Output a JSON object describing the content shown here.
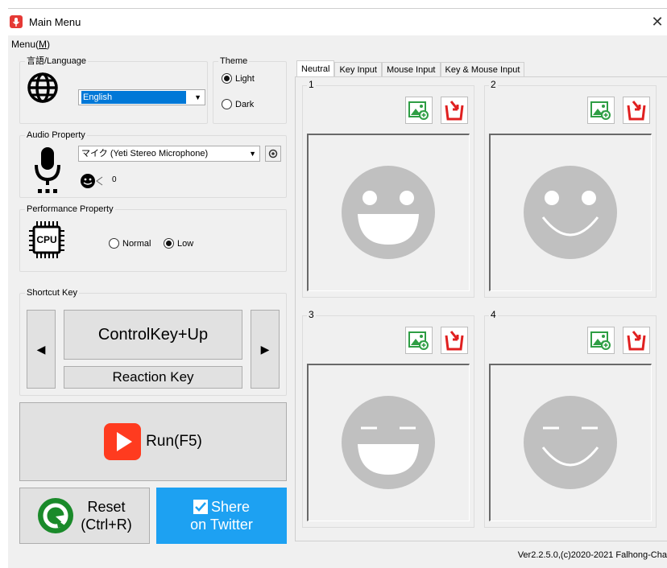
{
  "window": {
    "title": "Main Menu"
  },
  "menu": {
    "label": "Menu(",
    "accel": "M",
    "close": ")"
  },
  "language": {
    "group_label": "言語/Language",
    "selected": "English"
  },
  "theme": {
    "group_label": "Theme",
    "options": [
      {
        "label": "Light",
        "selected": true
      },
      {
        "label": "Dark",
        "selected": false
      }
    ]
  },
  "audio": {
    "group_label": "Audio Property",
    "device": "マイク (Yeti Stereo Microphone)",
    "level": "0"
  },
  "performance": {
    "group_label": "Performance Property",
    "chip_label": "CPU",
    "options": [
      {
        "label": "Normal",
        "selected": false
      },
      {
        "label": "Low",
        "selected": true
      }
    ]
  },
  "shortcut": {
    "group_label": "Shortcut Key",
    "key": "ControlKey+Up",
    "reaction": "Reaction Key"
  },
  "run": {
    "label": "Run(F5)"
  },
  "reset": {
    "line1": "Reset",
    "line2": "(Ctrl+R)"
  },
  "share": {
    "line1": "Shere",
    "line2": "on Twitter"
  },
  "tabs": [
    "Neutral",
    "Key Input",
    "Mouse Input",
    "Key & Mouse Input"
  ],
  "slots": [
    {
      "number": "1",
      "eyes": "open",
      "mouth": "open"
    },
    {
      "number": "2",
      "eyes": "open",
      "mouth": "closed"
    },
    {
      "number": "3",
      "eyes": "closed",
      "mouth": "open"
    },
    {
      "number": "4",
      "eyes": "closed",
      "mouth": "closed"
    }
  ],
  "footer": {
    "version": "Ver2.2.5.0,(c)2020-2021 Falhong-Cha"
  },
  "colors": {
    "accent": "#0078d7",
    "share_bg": "#1da1f2",
    "run_icon": "#ff3b1f",
    "face": "#c0c0c0",
    "load_icon": "#2e9e44",
    "clear_icon": "#e02020",
    "reset_icon": "#1a8a2a"
  }
}
